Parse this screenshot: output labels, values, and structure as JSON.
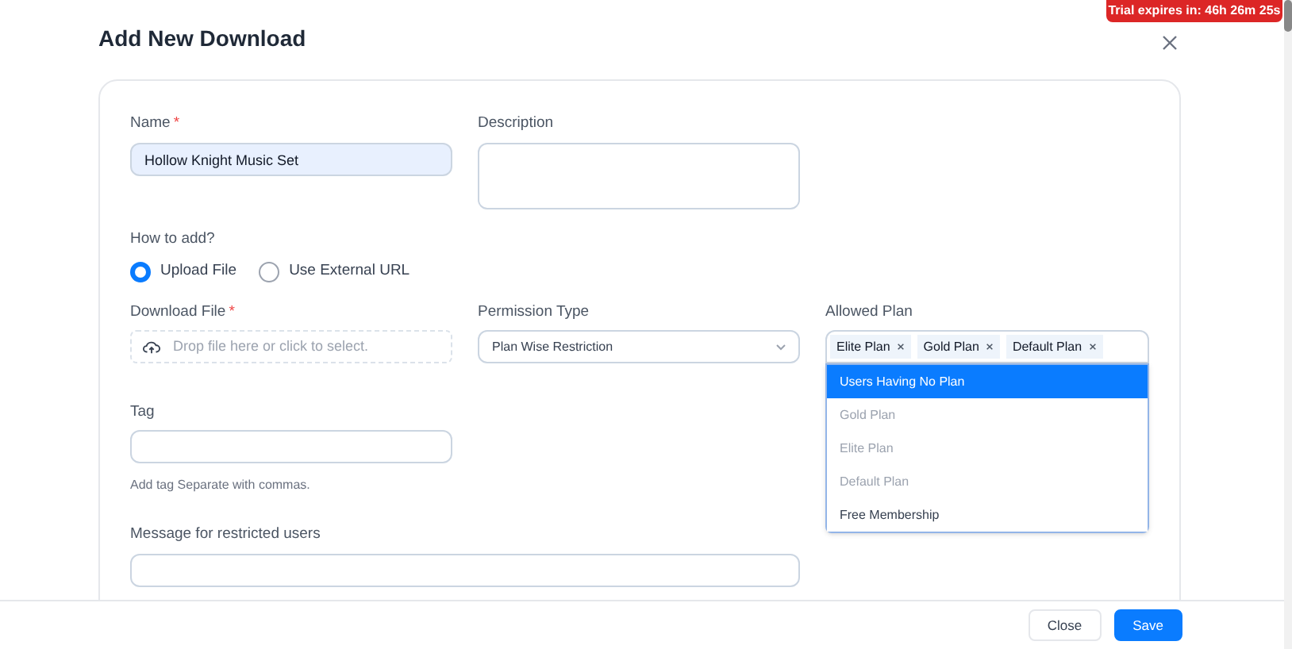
{
  "trial_badge": "Trial expires in: 46h 26m 25s",
  "dialog": {
    "title": "Add New Download"
  },
  "name": {
    "label": "Name",
    "required_mark": "*",
    "value": "Hollow Knight Music Set"
  },
  "description": {
    "label": "Description"
  },
  "how_to_add": {
    "label": "How to add?",
    "options": [
      {
        "label": "Upload File",
        "selected": true
      },
      {
        "label": "Use External URL",
        "selected": false
      }
    ]
  },
  "download_file": {
    "label": "Download File",
    "required_mark": "*",
    "placeholder": "Drop file here or click to select."
  },
  "permission_type": {
    "label": "Permission Type",
    "value": "Plan Wise Restriction"
  },
  "allowed_plan": {
    "label": "Allowed Plan",
    "tags": [
      "Elite Plan",
      "Gold Plan",
      "Default Plan"
    ],
    "options": [
      {
        "label": "Users Having No Plan",
        "selected": true,
        "disabled": false
      },
      {
        "label": "Gold Plan",
        "selected": false,
        "disabled": true
      },
      {
        "label": "Elite Plan",
        "selected": false,
        "disabled": true
      },
      {
        "label": "Default Plan",
        "selected": false,
        "disabled": true
      },
      {
        "label": "Free Membership",
        "selected": false,
        "disabled": false
      }
    ]
  },
  "tag": {
    "label": "Tag",
    "hint": "Add tag Separate with commas."
  },
  "restricted_message": {
    "label": "Message for restricted users"
  },
  "buttons": [
    {
      "label": "Close",
      "kind": "secondary"
    },
    {
      "label": "Save",
      "kind": "primary"
    }
  ]
}
